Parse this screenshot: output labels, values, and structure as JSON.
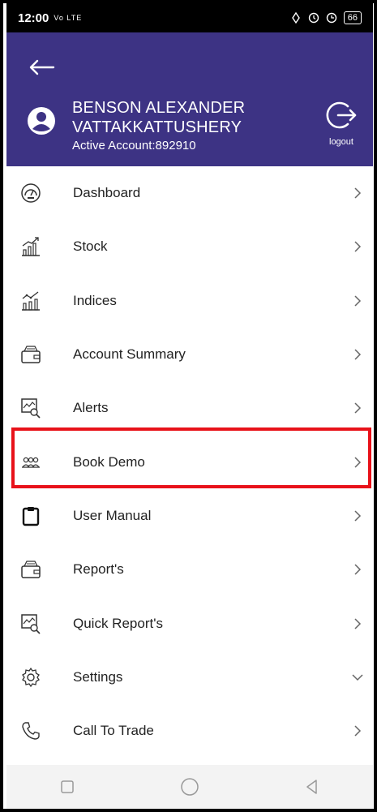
{
  "status_bar": {
    "time": "12:00",
    "network": "Vo LTE",
    "battery": "66"
  },
  "header": {
    "user_name_line1": "BENSON ALEXANDER",
    "user_name_line2": "VATTAKKATTUSHERY",
    "active_account": "Active Account:892910",
    "logout_label": "logout",
    "background_color": "#3d3384"
  },
  "menu": {
    "items": [
      {
        "label": "Dashboard",
        "icon": "dashboard-gauge-icon"
      },
      {
        "label": "Stock",
        "icon": "stock-chart-icon"
      },
      {
        "label": "Indices",
        "icon": "indices-chart-icon"
      },
      {
        "label": "Account Summary",
        "icon": "wallet-icon"
      },
      {
        "label": "Alerts",
        "icon": "alert-search-icon"
      },
      {
        "label": "Book Demo",
        "icon": "people-icon"
      },
      {
        "label": "User Manual",
        "icon": "clipboard-icon"
      },
      {
        "label": "Report's",
        "icon": "wallet-icon"
      },
      {
        "label": "Quick Report's",
        "icon": "report-search-icon"
      },
      {
        "label": "Settings",
        "icon": "gear-icon"
      },
      {
        "label": "Call To Trade",
        "icon": "phone-icon"
      }
    ],
    "highlight_color": "#e8121a"
  }
}
